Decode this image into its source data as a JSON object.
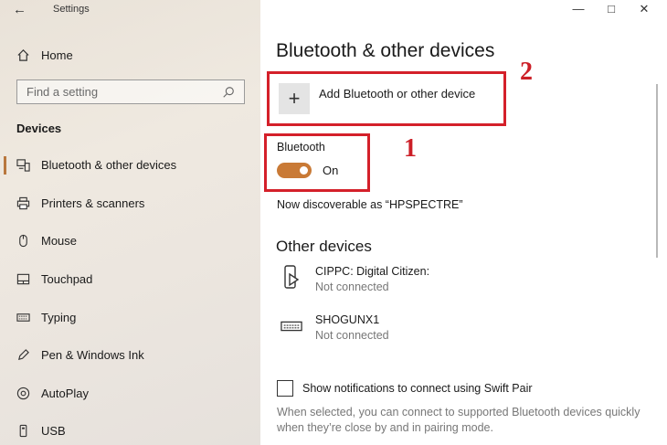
{
  "window": {
    "title": "Settings",
    "back_icon": "back-arrow-icon",
    "controls": [
      "minimize-icon",
      "maximize-icon",
      "close-icon"
    ]
  },
  "sidebar": {
    "home_label": "Home",
    "search_placeholder": "Find a setting",
    "section_title": "Devices",
    "items": [
      {
        "label": "Bluetooth & other devices",
        "icon": "bluetooth-devices-icon",
        "active": true
      },
      {
        "label": "Printers & scanners",
        "icon": "printer-icon"
      },
      {
        "label": "Mouse",
        "icon": "mouse-icon"
      },
      {
        "label": "Touchpad",
        "icon": "touchpad-icon"
      },
      {
        "label": "Typing",
        "icon": "keyboard-icon"
      },
      {
        "label": "Pen & Windows Ink",
        "icon": "pen-icon"
      },
      {
        "label": "AutoPlay",
        "icon": "autoplay-icon"
      },
      {
        "label": "USB",
        "icon": "usb-icon"
      }
    ]
  },
  "main": {
    "title": "Bluetooth & other devices",
    "add_device_label": "Add Bluetooth or other device",
    "bluetooth_label": "Bluetooth",
    "bluetooth_state": "On",
    "discoverable_text": "Now discoverable as “HPSPECTRE”",
    "other_devices_title": "Other devices",
    "devices": [
      {
        "name": "CIPPC: Digital Citizen:",
        "status": "Not connected",
        "icon": "phone-device-icon"
      },
      {
        "name": "SHOGUNX1",
        "status": "Not connected",
        "icon": "keyboard-device-icon"
      }
    ],
    "swift_pair_label": "Show notifications to connect using Swift Pair",
    "swift_pair_description": "When selected, you can connect to supported Bluetooth devices quickly when they’re close by and in pairing mode."
  },
  "annotations": [
    {
      "number": "2",
      "color": "#d4202a"
    },
    {
      "number": "1",
      "color": "#d4202a"
    }
  ],
  "colors": {
    "accent": "#c97a36",
    "annotation": "#d4202a",
    "sidebar_bg": "#ece6df"
  }
}
